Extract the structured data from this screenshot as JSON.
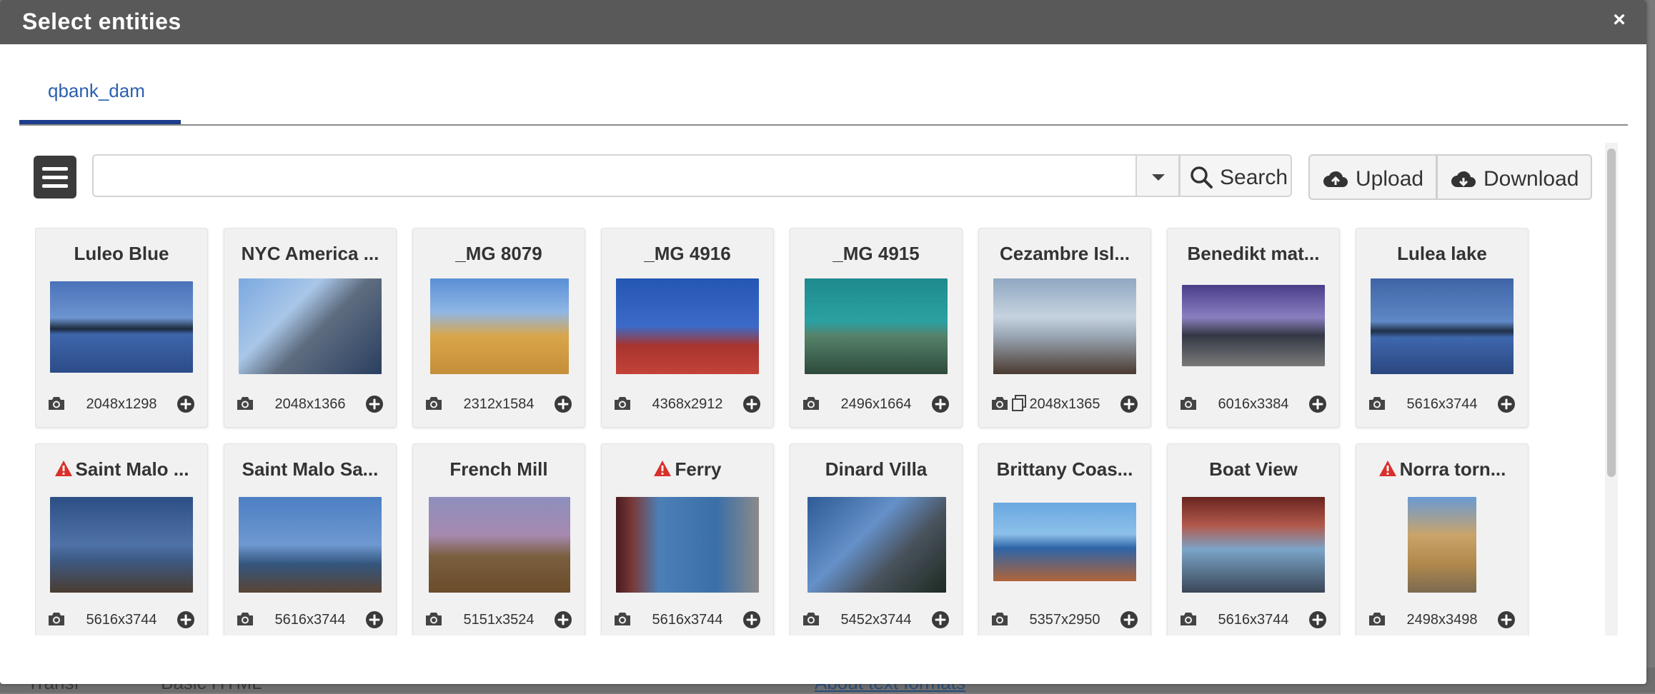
{
  "dialog": {
    "title": "Select entities",
    "close_label": "×"
  },
  "tabs": [
    {
      "label": "qbank_dam",
      "active": true
    }
  ],
  "toolbar": {
    "search_value": "",
    "search_label": "Search",
    "upload_label": "Upload",
    "download_label": "Download"
  },
  "background_page": {
    "fragment_1": "Transf",
    "fragment_2": "Basic HTML",
    "fragment_3": "About text formats"
  },
  "accent_colors": {
    "tab_underline": "#1d3e8c",
    "tab_text": "#2c5fb0",
    "warning": "#d9302c"
  },
  "cards": [
    {
      "title": "Luleo Blue",
      "dims": "2048x1298",
      "warning": false,
      "icon": "camera-icon"
    },
    {
      "title": "NYC America ...",
      "dims": "2048x1366",
      "warning": false,
      "icon": "camera-icon"
    },
    {
      "title": "_MG 8079",
      "dims": "2312x1584",
      "warning": false,
      "icon": "camera-icon"
    },
    {
      "title": "_MG 4916",
      "dims": "4368x2912",
      "warning": false,
      "icon": "camera-icon"
    },
    {
      "title": "_MG 4915",
      "dims": "2496x1664",
      "warning": false,
      "icon": "camera-icon"
    },
    {
      "title": "Cezambre Isl...",
      "dims": "2048x1365",
      "warning": false,
      "icon": "camera-icon",
      "extra_icon": "copy-icon"
    },
    {
      "title": "Benedikt mat...",
      "dims": "6016x3384",
      "warning": false,
      "icon": "camera-icon"
    },
    {
      "title": "Lulea lake",
      "dims": "5616x3744",
      "warning": false,
      "icon": "camera-icon"
    },
    {
      "title": "Saint Malo ...",
      "dims": "5616x3744",
      "warning": true,
      "icon": "camera-icon"
    },
    {
      "title": "Saint Malo Sa...",
      "dims": "5616x3744",
      "warning": false,
      "icon": "camera-icon"
    },
    {
      "title": "French Mill",
      "dims": "5151x3524",
      "warning": false,
      "icon": "camera-icon"
    },
    {
      "title": "Ferry",
      "dims": "5616x3744",
      "warning": true,
      "icon": "camera-icon"
    },
    {
      "title": "Dinard Villa",
      "dims": "5452x3744",
      "warning": false,
      "icon": "camera-icon"
    },
    {
      "title": "Brittany Coas...",
      "dims": "5357x2950",
      "warning": false,
      "icon": "camera-icon"
    },
    {
      "title": "Boat View",
      "dims": "5616x3744",
      "warning": false,
      "icon": "camera-icon"
    },
    {
      "title": "Norra torn...",
      "dims": "2498x3498",
      "warning": true,
      "icon": "camera-icon"
    }
  ]
}
